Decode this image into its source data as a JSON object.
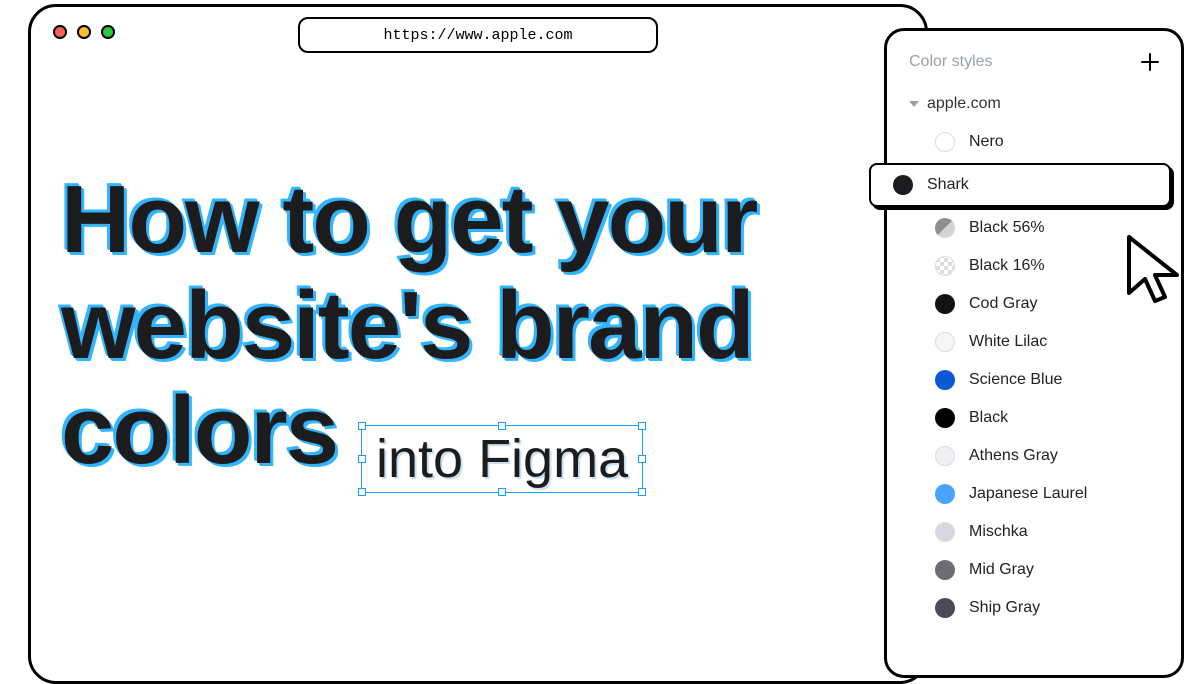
{
  "browser": {
    "url": "https://www.apple.com"
  },
  "headline": {
    "l1": "How to get your",
    "l2": "website's brand",
    "l3": "colors",
    "boxed": "into Figma"
  },
  "panel": {
    "title": "Color styles",
    "group": "apple.com",
    "styles": [
      {
        "name": "Nero",
        "color": "#ffffff",
        "bordered": true,
        "selected": false
      },
      {
        "name": "Shark",
        "color": "#1c1c1e",
        "bordered": false,
        "selected": true
      },
      {
        "name": "Black 56%",
        "color": "#8e8e93",
        "bordered": false,
        "selected": false,
        "gradient": "linear-gradient(135deg,#8e8e93 50%,#d4d4d6 50%)"
      },
      {
        "name": "Black 16%",
        "color": "#e6e6e8",
        "bordered": true,
        "selected": false,
        "checker": true
      },
      {
        "name": "Cod Gray",
        "color": "#111111",
        "bordered": false,
        "selected": false
      },
      {
        "name": "White Lilac",
        "color": "#f6f6f9",
        "bordered": true,
        "selected": false
      },
      {
        "name": "Science Blue",
        "color": "#0a5bd3",
        "bordered": false,
        "selected": false
      },
      {
        "name": "Black",
        "color": "#000000",
        "bordered": false,
        "selected": false
      },
      {
        "name": "Athens Gray",
        "color": "#eef0f3",
        "bordered": true,
        "selected": false
      },
      {
        "name": "Japanese Laurel",
        "color": "#4aa3ff",
        "bordered": false,
        "selected": false
      },
      {
        "name": "Mischka",
        "color": "#d6d8de",
        "bordered": true,
        "selected": false
      },
      {
        "name": "Mid Gray",
        "color": "#6b6d73",
        "bordered": false,
        "selected": false
      },
      {
        "name": "Ship Gray",
        "color": "#4a4c52",
        "bordered": false,
        "selected": false
      }
    ]
  }
}
